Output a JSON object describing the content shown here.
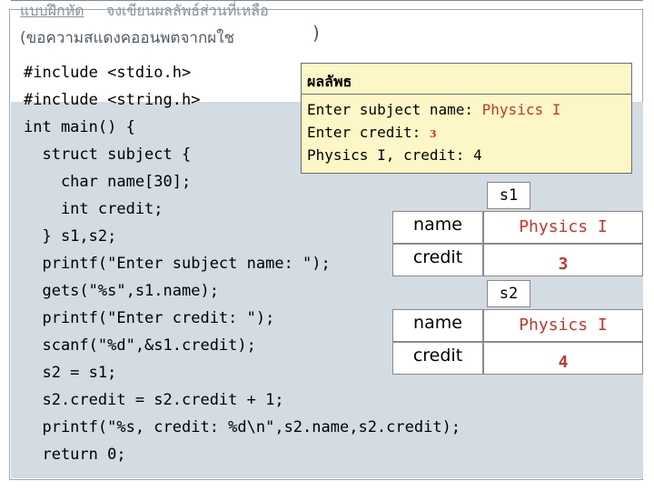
{
  "slide": {
    "title": "แบบฝึกหัด",
    "instruction": "จงเขียนผลลัพธ์ส่วนที่เหลือ",
    "subtitle": "(ขอความสแดงคออนพตจากผใช",
    "subtitle_close": ")"
  },
  "code": [
    "#include <stdio.h>",
    "#include <string.h>",
    "int main() {",
    "  struct subject {",
    "    char name[30];",
    "    int credit;",
    "  } s1,s2;",
    "  printf(\"Enter subject name: \");",
    "  gets(\"%s\",s1.name);",
    "  printf(\"Enter credit: \");",
    "  scanf(\"%d\",&s1.credit);",
    "  s2 = s1;",
    "  s2.credit = s2.credit + 1;",
    "  printf(\"%s, credit: %d\\n\",s2.name,s2.credit);",
    "  return 0;"
  ],
  "output": {
    "title": "ผลลัพธ",
    "line1_prompt": "Enter subject name: ",
    "line1_input": "Physics I",
    "line2_prompt": "Enter credit: ",
    "line2_input": "3",
    "line3": "Physics I, credit: 4"
  },
  "structs": {
    "s1": {
      "label": "s1",
      "name_label": "name",
      "name_value": "Physics I",
      "credit_label": "credit",
      "credit_value": "3"
    },
    "s2": {
      "label": "s2",
      "name_label": "name",
      "name_value": "Physics I",
      "credit_label": "credit",
      "credit_value": "4"
    }
  },
  "colors": {
    "input_text": "#c0392b",
    "output_bg": "#fdf7c7",
    "code_area_bg": "#d3dbe3"
  }
}
